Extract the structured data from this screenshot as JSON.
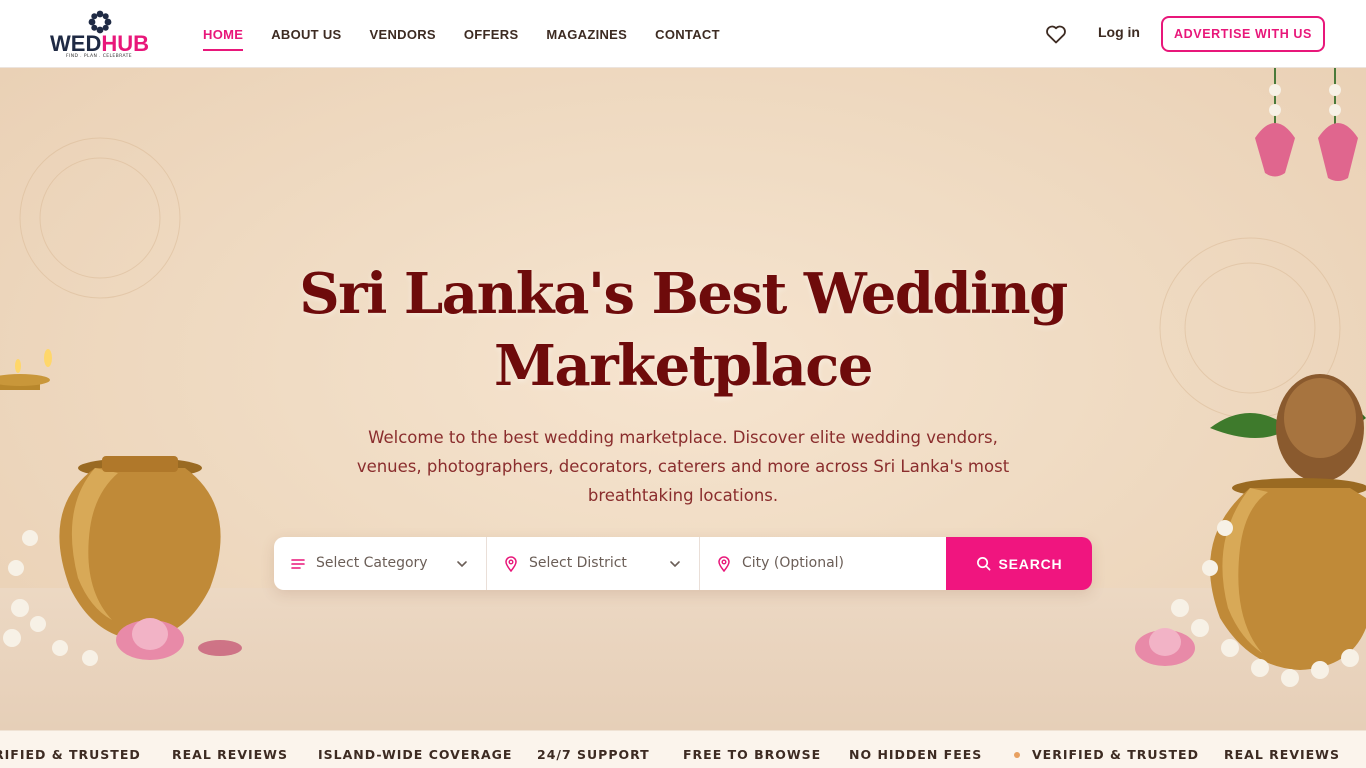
{
  "brand": {
    "logo_main": "WED",
    "logo_accent": "HUB",
    "tagline": "FIND . PLAN . CELEBRATE"
  },
  "nav": {
    "items": [
      {
        "label": "HOME",
        "active": true
      },
      {
        "label": "ABOUT US"
      },
      {
        "label": "VENDORS"
      },
      {
        "label": "OFFERS"
      },
      {
        "label": "MAGAZINES"
      },
      {
        "label": "CONTACT"
      }
    ],
    "favorites_icon": "heart-icon",
    "login_label": "Log in",
    "advertise_label": "ADVERTISE WITH US"
  },
  "hero": {
    "title": "Sri Lanka's Best Wedding Marketplace",
    "subtitle": "Welcome to the best wedding marketplace. Discover elite wedding vendors, venues, photographers, decorators, caterers and more across Sri Lanka's most breathtaking locations."
  },
  "search": {
    "category_placeholder": "Select Category",
    "district_placeholder": "Select District",
    "city_placeholder": "City (Optional)",
    "button_label": "SEARCH"
  },
  "ticker": {
    "items": [
      "RIFIED & TRUSTED",
      "REAL REVIEWS",
      "ISLAND-WIDE COVERAGE",
      "24/7 SUPPORT",
      "FREE TO BROWSE",
      "NO HIDDEN FEES",
      "VERIFIED & TRUSTED",
      "REAL REVIEWS"
    ]
  },
  "colors": {
    "accent": "#e8177a",
    "title": "#6e0b0b",
    "nav_text": "#3d2b22"
  }
}
